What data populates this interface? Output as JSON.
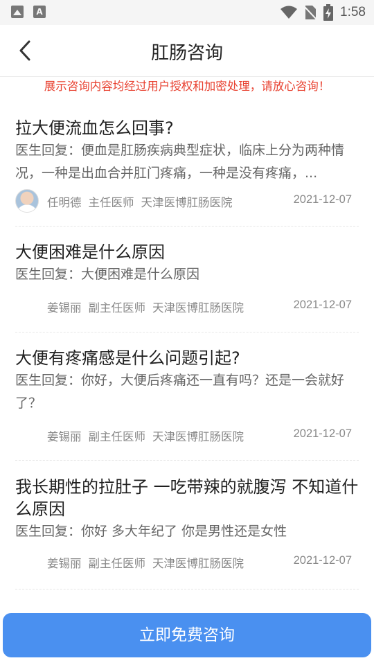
{
  "status_bar": {
    "time": "1:58"
  },
  "header": {
    "title": "肛肠咨询"
  },
  "notice": "展示咨询内容均经过用户授权和加密处理，请放心咨询！",
  "answer_prefix": "医生回复：",
  "items": [
    {
      "question": "拉大便流血怎么回事?",
      "answer": "便血是肛肠疾病典型症状，临床上分为两种情况，一种是出血合并肛门疼痛，一种是没有疼痛，...",
      "doctor": "任明德",
      "title": "主任医师",
      "hospital": "天津医博肛肠医院",
      "date": "2021-12-07",
      "has_avatar": true
    },
    {
      "question": "大便困难是什么原因",
      "answer": "大便困难是什么原因",
      "doctor": "姜锡丽",
      "title": "副主任医师",
      "hospital": "天津医博肛肠医院",
      "date": "2021-12-07",
      "has_avatar": false
    },
    {
      "question": "大便有疼痛感是什么问题引起?",
      "answer": "你好，大便后疼痛还一直有吗？还是一会就好了？",
      "doctor": "姜锡丽",
      "title": "副主任医师",
      "hospital": "天津医博肛肠医院",
      "date": "2021-12-07",
      "has_avatar": false
    },
    {
      "question": "我长期性的拉肚子 一吃带辣的就腹泻 不知道什么原因",
      "answer": "你好 多大年纪了 你是男性还是女性",
      "doctor": "姜锡丽",
      "title": "副主任医师",
      "hospital": "天津医博肛肠医院",
      "date": "2021-12-07",
      "has_avatar": false
    }
  ],
  "cta_label": "立即免费咨询"
}
